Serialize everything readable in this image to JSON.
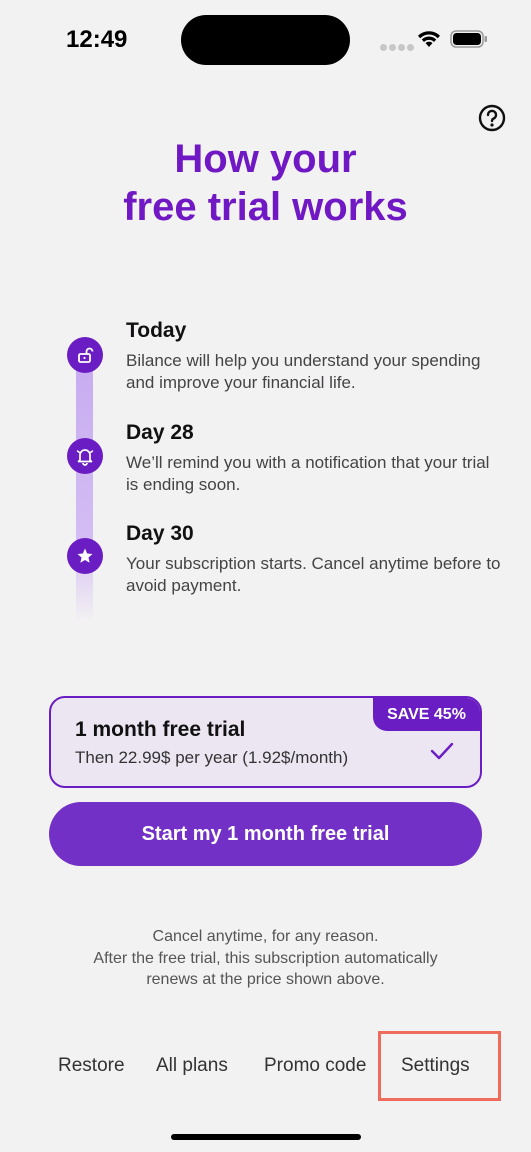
{
  "status_bar": {
    "time": "12:49"
  },
  "header": {
    "title_line1": "How your",
    "title_line2": "free trial works"
  },
  "timeline": [
    {
      "title": "Today",
      "description": "Bilance will help you understand your spending and improve your financial life.",
      "icon": "unlock-icon"
    },
    {
      "title": "Day 28",
      "description": "We’ll remind you with a notification that your trial is ending soon.",
      "icon": "bell-icon"
    },
    {
      "title": "Day 30",
      "description": "Your subscription starts. Cancel anytime before to avoid payment.",
      "icon": "star-icon"
    }
  ],
  "plan": {
    "name": "1 month free trial",
    "price": "Then 22.99$ per year (1.92$/month)",
    "badge": "SAVE 45%",
    "selected": true
  },
  "cta": {
    "label": "Start my 1 month free trial"
  },
  "disclaimer": {
    "line1": "Cancel anytime, for any reason.",
    "line2": "After the free trial, this subscription automatically",
    "line3": "renews at the price shown above."
  },
  "footer": {
    "restore": "Restore",
    "all_plans": "All plans",
    "promo_code": "Promo code",
    "settings": "Settings"
  },
  "colors": {
    "accent": "#6a1dc2",
    "title": "#7018c4",
    "background": "#f3f2f3",
    "highlight": "#ee6c5c"
  }
}
